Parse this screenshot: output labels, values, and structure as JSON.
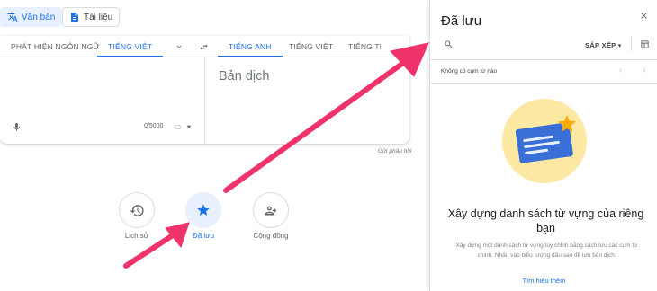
{
  "modes": {
    "text_label": "Văn bản",
    "docs_label": "Tài liệu"
  },
  "languages": {
    "source": [
      "PHÁT HIỆN NGÔN NGỮ",
      "TIẾNG VIỆT"
    ],
    "target": [
      "TIẾNG ANH",
      "TIẾNG VIỆT",
      "TIẾNG TRU"
    ]
  },
  "editor": {
    "placeholder": "Bản dịch",
    "char_count": "0/5000",
    "feedback_link": "Gửi phản hồi"
  },
  "shortcuts": {
    "history_label": "Lịch sử",
    "saved_label": "Đã lưu",
    "community_label": "Cộng đồng"
  },
  "saved_panel": {
    "title": "Đã lưu",
    "sort_label": "SẮP XẾP",
    "empty_text": "Không có cụm từ nào",
    "heading": "Xây dựng danh sách từ vựng của riêng bạn",
    "description": "Xây dựng một danh sách từ vựng tùy chỉnh bằng cách lưu các cụm từ chính. Nhấn vào biểu tượng dấu sao để lưu bản dịch.",
    "learn_more": "Tìm hiểu thêm"
  },
  "colors": {
    "accent": "#1a73e8",
    "arrow": "#f0336b",
    "star_gold": "#f9ab00",
    "illustration_bg": "#fde9a4"
  },
  "icons": [
    "translate-icon",
    "document-icon",
    "chevron-down-icon",
    "swap-icon",
    "mic-icon",
    "search-icon",
    "close-icon",
    "grid-icon",
    "history-icon",
    "star-icon",
    "people-icon"
  ]
}
